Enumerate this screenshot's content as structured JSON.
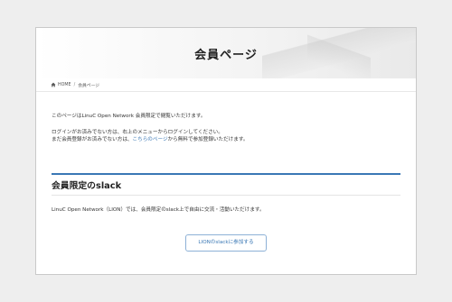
{
  "hero": {
    "title": "会員ページ"
  },
  "breadcrumb": {
    "home": "HOME",
    "separator": "/",
    "current": "会員ページ"
  },
  "intro": {
    "line1": "このページはLinuC Open Network 会員限定で閲覧いただけます。",
    "line2": "ログインがお済みでない方は、右上のメニューからログインしてください。",
    "line3_prefix": "まだ会員登録がお済みでない方は、",
    "line3_link": "こちらのページ",
    "line3_suffix": "から無料で参加登録いただけます。"
  },
  "section": {
    "title": "会員限定のslack",
    "text": "LinuC Open Network（LION）では、会員限定のslack上で自由に交流・活動いただけます。",
    "button": "LIONのslackに参加する"
  },
  "colors": {
    "accent": "#3a78b5",
    "background": "#eeeeee",
    "card": "#ffffff"
  },
  "icons": {
    "breadcrumb_home": "home-icon"
  }
}
